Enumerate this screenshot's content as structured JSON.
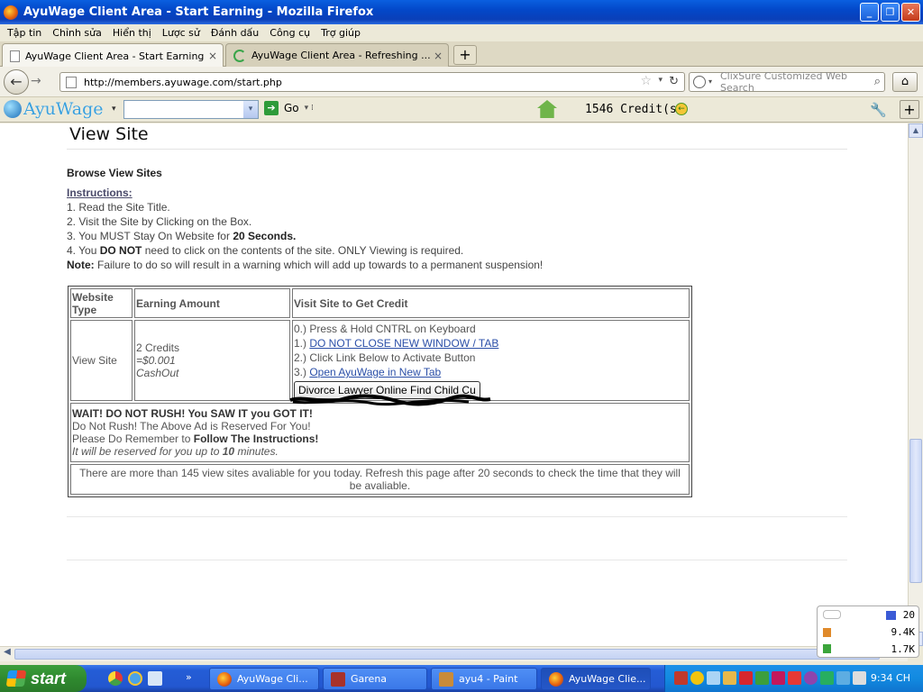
{
  "window": {
    "title": "AyuWage Client Area - Start Earning - Mozilla Firefox",
    "minimize_label": "_",
    "maximize_label": "❐",
    "close_label": "✕"
  },
  "menu": [
    "Tập tin",
    "Chỉnh sửa",
    "Hiển thị",
    "Lược sử",
    "Đánh dấu",
    "Công cụ",
    "Trợ giúp"
  ],
  "tabs": [
    {
      "label": "AyuWage Client Area - Start Earning",
      "active": true
    },
    {
      "label": "AyuWage Client Area - Refreshing ...",
      "active": false
    }
  ],
  "tab_close": "×",
  "newtab_label": "+",
  "nav": {
    "back": "←",
    "forward": "→",
    "url": "http://members.ayuwage.com/start.php",
    "star": "☆",
    "dropdown": "▾",
    "reload": "↻",
    "search_placeholder": "ClixSure Customized Web Search",
    "search_drop": "▾",
    "search_go": "⌕",
    "home": "⌂"
  },
  "toolbar": {
    "logo": "AyuWage",
    "logo_drop": "▾",
    "select_arrow": "▾",
    "go_icon": "➔",
    "go_label": "Go",
    "go_drop": "▾ ⁞",
    "credits": "1546 Credit(s)",
    "credits_icon": "←",
    "wrench": "🔧",
    "plus": "+"
  },
  "page": {
    "title": "View Site",
    "browse_title": "Browse View Sites",
    "instructions_head": "Instructions:",
    "instructions": [
      {
        "pre": "1. Read the Site Title.",
        "bold": "",
        "post": ""
      },
      {
        "pre": "2. Visit the Site by Clicking on the Box.",
        "bold": "",
        "post": ""
      },
      {
        "pre": "3. You MUST Stay On Website for ",
        "bold": "20 Seconds.",
        "post": ""
      },
      {
        "pre": "4. You ",
        "bold": "DO NOT",
        "post": " need to click on the contents of the site. ONLY Viewing is required."
      }
    ],
    "note_label": "Note:",
    "note_text": " Failure to do so will result in a warning which will add up towards to a permanent suspension!"
  },
  "table": {
    "headers": [
      "Website Type",
      "Earning Amount",
      "Visit Site to Get Credit"
    ],
    "type": "View Site",
    "earning_credits": "2 Credits",
    "earning_cash": "=$0.001",
    "earning_cashout": "CashOut",
    "step0": "0.) Press & Hold CNTRL on Keyboard",
    "step1_pre": "1.) ",
    "step1_link": "DO NOT CLOSE NEW WINDOW / TAB",
    "step2": "2.) Click Link Below to Activate Button",
    "step3_pre": "3.) ",
    "step3_link": "Open AyuWage in New Tab",
    "ad_button": "Divorce Lawyer Online Find Child Cu",
    "wait_bold": "WAIT! DO NOT RUSH! You SAW IT you GOT IT!",
    "wait_line2": "Do Not Rush! The Above Ad is Reserved For You!",
    "wait_line3_pre": "Please Do Remember to ",
    "wait_line3_bold": "Follow The Instructions!",
    "wait_line4_pre": "It will be reserved for you up to ",
    "wait_line4_bold": "10",
    "wait_line4_post": " minutes.",
    "footer": "There are more than 145 view sites avaliable for you today. Refresh this page after 20 seconds to check the time that they will be avaliable."
  },
  "netmeter": {
    "count": "20",
    "up": "9.4K",
    "down": "1.7K"
  },
  "taskbar": {
    "start": "start",
    "ql_more": "»",
    "tasks": [
      "AyuWage Cli...",
      "Garena",
      "ayu4 - Paint",
      "AyuWage Clie..."
    ],
    "clock": "9:34 CH"
  },
  "scroll": {
    "up": "▲",
    "down": "▼",
    "left": "◀",
    "right": "▶"
  }
}
